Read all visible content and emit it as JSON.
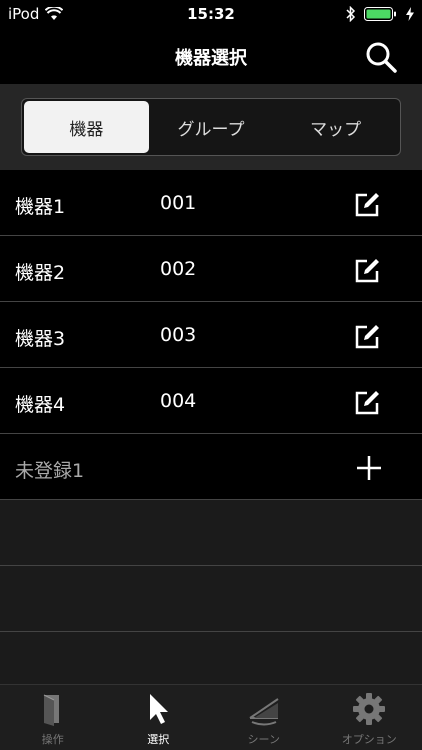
{
  "status": {
    "carrier": "iPod",
    "time": "15:32"
  },
  "nav": {
    "title": "機器選択"
  },
  "segments": [
    {
      "label": "機器",
      "active": true
    },
    {
      "label": "グループ",
      "active": false
    },
    {
      "label": "マップ",
      "active": false
    }
  ],
  "devices": [
    {
      "name": "機器1",
      "id": "001"
    },
    {
      "name": "機器2",
      "id": "002"
    },
    {
      "name": "機器3",
      "id": "003"
    },
    {
      "name": "機器4",
      "id": "004"
    }
  ],
  "unregistered": {
    "name": "未登録1"
  },
  "tabs": [
    {
      "label": "操作",
      "icon": "operate-icon"
    },
    {
      "label": "選択",
      "icon": "cursor-icon"
    },
    {
      "label": "シーン",
      "icon": "scene-icon"
    },
    {
      "label": "オプション",
      "icon": "gear-icon"
    }
  ],
  "colors": {
    "background": "#1b1b1b",
    "row": "#000000",
    "segment_active": "#f2f2f2"
  }
}
